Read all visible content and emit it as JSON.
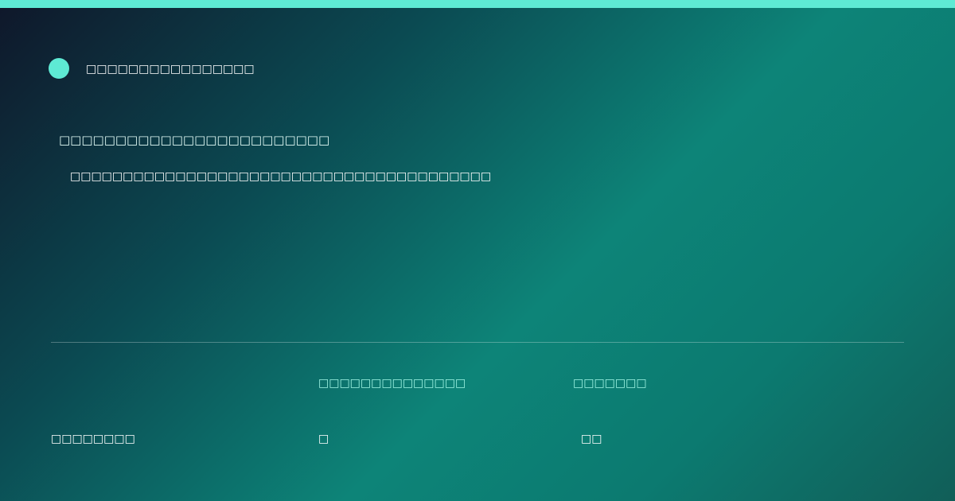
{
  "brand": {
    "name": "□□□□□□□□□□□□□□□□"
  },
  "hero": {
    "eyebrow": "□□□□□□□□□□□□□□□□□□□□□□□□",
    "subtitle": "□□□□□□□□□□□□□□□□□□□□□□□□□□□□□□□□□□□□□□□□"
  },
  "stats": {
    "headers": [
      "□□□□□□□□□□□□□□",
      "□□□□□□□"
    ],
    "values": [
      "□□□□□□□□",
      "□",
      "□□"
    ]
  },
  "colors": {
    "accent": "#5eead4",
    "background_start": "#0f172a",
    "background_mid": "#0d8478",
    "background_end": "#115e58"
  }
}
